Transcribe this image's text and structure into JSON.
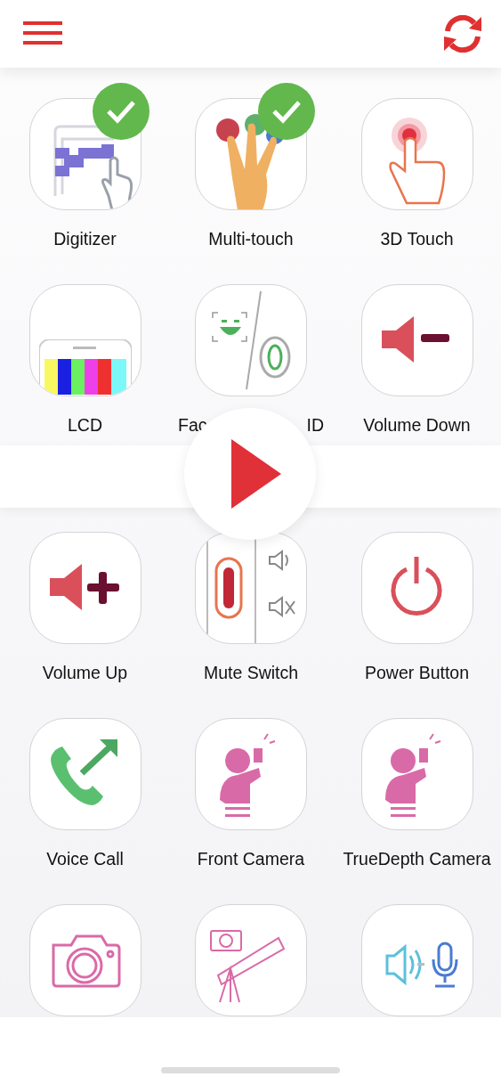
{
  "tests": [
    {
      "label": "Digitizer",
      "checked": true
    },
    {
      "label": "Multi-touch",
      "checked": true
    },
    {
      "label": "3D Touch",
      "checked": false
    },
    {
      "label": "LCD",
      "checked": false
    },
    {
      "label": "Fac",
      "label_tail": "ID",
      "checked": false
    },
    {
      "label": "Volume Down",
      "checked": false
    },
    {
      "label": "Volume Up",
      "checked": false
    },
    {
      "label": "Mute Switch",
      "checked": false
    },
    {
      "label": "Power Button",
      "checked": false
    },
    {
      "label": "Voice Call",
      "checked": false
    },
    {
      "label": "Front Camera",
      "checked": false
    },
    {
      "label": "TrueDepth Camera",
      "checked": false
    },
    {
      "checked": false
    },
    {
      "checked": false
    },
    {
      "checked": false
    }
  ]
}
